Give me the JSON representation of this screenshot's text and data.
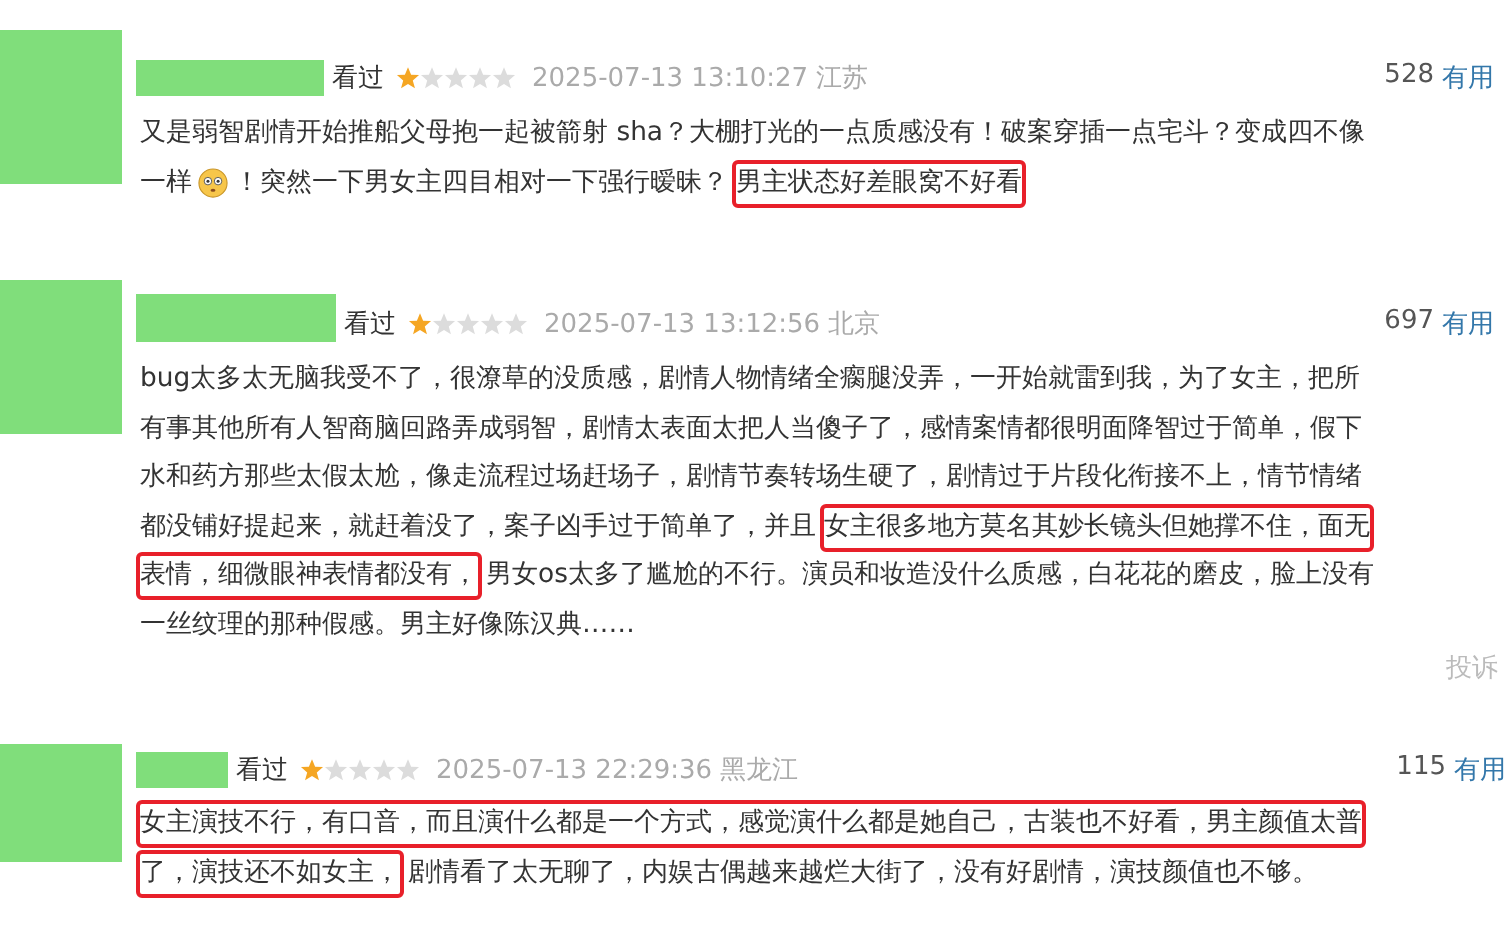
{
  "reviews": [
    {
      "status": "看过",
      "stars": 1,
      "time": "2025-07-13 13:10:27",
      "location": "江苏",
      "votes": "528",
      "vote_label": "有用",
      "lines": [
        [
          {
            "text": "又是弱智剧情开始推船父母抱一起被箭射 sha？大棚打光的一点质感没有！破案穿插一点宅斗？变成四不像",
            "highlighted": false
          }
        ],
        [
          {
            "text": "一样",
            "highlighted": false
          },
          {
            "kind": "emoji"
          },
          {
            "text": "！突然一下男女主四目相对一下强行暧昧？",
            "highlighted": false
          },
          {
            "text": "男主状态好差眼窝不好看",
            "highlighted": true
          }
        ]
      ]
    },
    {
      "status": "看过",
      "stars": 1,
      "time": "2025-07-13 13:12:56",
      "location": "北京",
      "votes": "697",
      "vote_label": "有用",
      "report": "投诉",
      "lines": [
        [
          {
            "text": "bug太多太无脑我受不了，很潦草的没质感，剧情人物情绪全瘸腿没弄，一开始就雷到我，为了女主，把所",
            "highlighted": false
          }
        ],
        [
          {
            "text": "有事其他所有人智商脑回路弄成弱智，剧情太表面太把人当傻子了，感情案情都很明面降智过于简单，假下",
            "highlighted": false
          }
        ],
        [
          {
            "text": "水和药方那些太假太尬，像走流程过场赶场子，剧情节奏转场生硬了，剧情过于片段化衔接不上，情节情绪",
            "highlighted": false
          }
        ],
        [
          {
            "text": "都没铺好提起来，就赶着没了，案子凶手过于简单了，并且",
            "highlighted": false
          },
          {
            "text": "女主很多地方莫名其妙长镜头但她撑不住，面无",
            "highlighted": true
          }
        ],
        [
          {
            "text": "表情，细微眼神表情都没有，",
            "highlighted": true
          },
          {
            "text": "男女os太多了尴尬的不行。演员和妆造没什么质感，白花花的磨皮，脸上没有",
            "highlighted": false
          }
        ],
        [
          {
            "text": "一丝纹理的那种假感。男主好像陈汉典……",
            "highlighted": false
          }
        ]
      ]
    },
    {
      "status": "看过",
      "stars": 1,
      "time": "2025-07-13 22:29:36",
      "location": "黑龙江",
      "votes": "115",
      "vote_label": "有用",
      "lines": [
        [
          {
            "text": "女主演技不行，有口音，而且演什么都是一个方式，感觉演什么都是她自己，古装也不好看，男主颜值太普",
            "highlighted": true
          }
        ],
        [
          {
            "text": "了，演技还不如女主，",
            "highlighted": true
          },
          {
            "text": "剧情看了太无聊了，内娱古偶越来越烂大街了，没有好剧情，演技颜值也不够。",
            "highlighted": false
          }
        ]
      ]
    }
  ]
}
